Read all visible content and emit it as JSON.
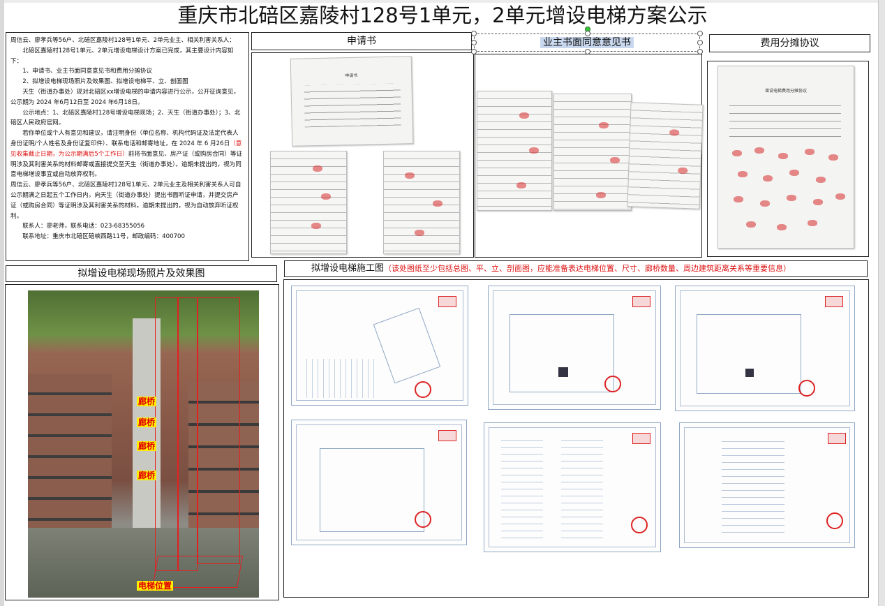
{
  "title": "重庆市北碚区嘉陵村128号1单元，2单元增设电梯方案公示",
  "notice": {
    "address_line": "周信云、廖孝兵等56户、北碚区嘉陵村128号1单元、2单元业主、相关利害关系人：",
    "intro": "北碚区嘉陵村128号1单元、2单元增设电梯设计方案已完成，其主要设计内容如下：",
    "item1": "1、申请书、业主书面同意意见书和费用分摊协议",
    "item2": "2、拟增设电梯现场照片及效果图、拟增设电梯平、立、剖面图",
    "period": "天生（街道办事处）现对北碚区xx增设电梯的申请内容进行公示，公开征询意见，公示期为 2024 年6月12日至 2024 年6月18日。",
    "location": "公示地点：1、北碚区嘉陵村128号增设电梯现场；2、天生（街道办事处）；3、北碚区人民政府官网。",
    "objection_pre": "若你单位或个人有意见和建议，请注明身份（单位名称、机构代码证及法定代表人身份证明/个人姓名及身份证复印件）、联系电话和邮寄地址，在 2024 年 6 月26日",
    "objection_red": "（意见收集截止日期，为公示期满后5个工作日）",
    "objection_post": "前将书面意见、房产证（或购房合同）等证明涉及其利害关系的材料邮寄或直接提交至天生（街道办事处）。逾期未提出的，视为同意电梯增设事宜或自动放弃权利。",
    "hearing": "周信云、廖孝兵等56户、北碚区嘉陵村128号1单元、2单元业主及相关利害关系人可自公示期满之日起五个工作日内，向天生（街道办事处）提出书面听证申请，并提交房产证（或购房合同）等证明涉及其利害关系的材料。逾期未提出的，视为自动放弃听证权利。",
    "contact": "联系人：廖老师，联系电话：023-68355056",
    "contact_address": "联系地址：重庆市北碚区碚峡西路11号，邮政编码：400700"
  },
  "panels": {
    "application": "申请书",
    "consent": "业主书面同意意见书",
    "cost": "费用分摊协议",
    "photos": "拟增设电梯现场照片及效果图",
    "drawings_title": "拟增设电梯施工图",
    "drawings_note": "（该处图纸至少包括总图、平、立、剖面图，应能准备表达电梯位置、尺寸、廊桥数量、周边建筑距离关系等重要信息）"
  },
  "photo_labels": {
    "bridge": "廊桥",
    "elevator": "电梯位置"
  },
  "colors": {
    "note_red": "#d11111",
    "label_yellow": "#ffee00",
    "selection": "#c9d8ee"
  }
}
